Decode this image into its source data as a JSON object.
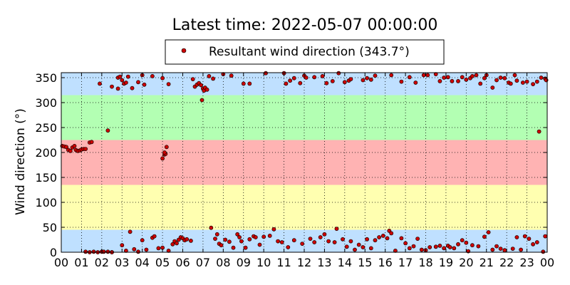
{
  "chart_data": {
    "type": "scatter",
    "title": "Latest time: 2022-05-07 00:00:00",
    "xlabel": "",
    "ylabel": "Wind direction (°)",
    "xlim": [
      0,
      24
    ],
    "ylim": [
      0,
      360
    ],
    "x_ticks": [
      "00",
      "01",
      "02",
      "03",
      "04",
      "05",
      "06",
      "07",
      "08",
      "09",
      "10",
      "11",
      "12",
      "13",
      "14",
      "15",
      "16",
      "17",
      "18",
      "19",
      "20",
      "21",
      "22",
      "23",
      "00"
    ],
    "y_ticks": [
      0,
      50,
      100,
      150,
      200,
      250,
      300,
      350
    ],
    "grid": true,
    "legend": {
      "placement": "top-center",
      "label": "Resultant wind direction (343.7°)"
    },
    "marker_color": "#cc0000",
    "bands": [
      {
        "from": 0,
        "to": 45,
        "color": "#bfe0ff"
      },
      {
        "from": 45,
        "to": 135,
        "color": "#ffffb0"
      },
      {
        "from": 135,
        "to": 225,
        "color": "#ffb3b3"
      },
      {
        "from": 225,
        "to": 315,
        "color": "#b3ffb3"
      },
      {
        "from": 315,
        "to": 360,
        "color": "#bfe0ff"
      }
    ],
    "series": [
      {
        "name": "Resultant wind direction (343.7°)",
        "points": [
          [
            0.05,
            213
          ],
          [
            0.15,
            212
          ],
          [
            0.25,
            211
          ],
          [
            0.35,
            205
          ],
          [
            0.45,
            203
          ],
          [
            0.55,
            210
          ],
          [
            0.65,
            213
          ],
          [
            0.72,
            205
          ],
          [
            0.82,
            203
          ],
          [
            0.92,
            204
          ],
          [
            1.0,
            206
          ],
          [
            1.1,
            207
          ],
          [
            1.2,
            207
          ],
          [
            1.4,
            220
          ],
          [
            1.5,
            221
          ],
          [
            1.2,
            1
          ],
          [
            1.4,
            0
          ],
          [
            1.6,
            1
          ],
          [
            1.8,
            0
          ],
          [
            2.0,
            1
          ],
          [
            2.1,
            1
          ],
          [
            2.3,
            1
          ],
          [
            2.5,
            0
          ],
          [
            2.5,
            0
          ],
          [
            1.9,
            338
          ],
          [
            2.3,
            244
          ],
          [
            2.5,
            332
          ],
          [
            2.8,
            328
          ],
          [
            2.8,
            350
          ],
          [
            2.9,
            352
          ],
          [
            3.0,
            345
          ],
          [
            3.1,
            338
          ],
          [
            3.2,
            340
          ],
          [
            3.3,
            352
          ],
          [
            3.5,
            329
          ],
          [
            3.8,
            341
          ],
          [
            4.0,
            355
          ],
          [
            4.1,
            336
          ],
          [
            4.5,
            353
          ],
          [
            5.0,
            349
          ],
          [
            5.3,
            337
          ],
          [
            3.0,
            14
          ],
          [
            3.2,
            3
          ],
          [
            3.4,
            41
          ],
          [
            3.6,
            6
          ],
          [
            3.8,
            1
          ],
          [
            4.0,
            24
          ],
          [
            4.2,
            5
          ],
          [
            4.5,
            29
          ],
          [
            4.6,
            32
          ],
          [
            4.8,
            8
          ],
          [
            5.0,
            9
          ],
          [
            5.3,
            3
          ],
          [
            5.0,
            188
          ],
          [
            5.1,
            196
          ],
          [
            5.15,
            197
          ],
          [
            5.2,
            211
          ],
          [
            5.1,
            200
          ],
          [
            5.5,
            16
          ],
          [
            5.6,
            22
          ],
          [
            5.7,
            18
          ],
          [
            5.8,
            25
          ],
          [
            5.9,
            30
          ],
          [
            6.0,
            28
          ],
          [
            6.1,
            24
          ],
          [
            6.2,
            26
          ],
          [
            6.4,
            23
          ],
          [
            6.5,
            347
          ],
          [
            6.6,
            332
          ],
          [
            6.7,
            336
          ],
          [
            6.8,
            339
          ],
          [
            6.9,
            335
          ],
          [
            6.95,
            305
          ],
          [
            7.0,
            328
          ],
          [
            7.05,
            324
          ],
          [
            7.1,
            330
          ],
          [
            7.2,
            326
          ],
          [
            7.3,
            353
          ],
          [
            7.5,
            348
          ],
          [
            7.4,
            49
          ],
          [
            7.6,
            27
          ],
          [
            7.7,
            36
          ],
          [
            7.8,
            17
          ],
          [
            7.9,
            14
          ],
          [
            8.1,
            25
          ],
          [
            8.3,
            21
          ],
          [
            8.5,
            9
          ],
          [
            8.7,
            36
          ],
          [
            8.8,
            30
          ],
          [
            8.9,
            22
          ],
          [
            9.1,
            9
          ],
          [
            9.3,
            26
          ],
          [
            9.5,
            32
          ],
          [
            9.6,
            30
          ],
          [
            9.8,
            15
          ],
          [
            10.0,
            31
          ],
          [
            10.3,
            33
          ],
          [
            10.5,
            46
          ],
          [
            10.7,
            22
          ],
          [
            10.9,
            20
          ],
          [
            8.0,
            357
          ],
          [
            8.4,
            354
          ],
          [
            9.0,
            338
          ],
          [
            9.3,
            338
          ],
          [
            10.1,
            359
          ],
          [
            11.0,
            359
          ],
          [
            11.1,
            338
          ],
          [
            11.3,
            344
          ],
          [
            11.5,
            349
          ],
          [
            11.8,
            339
          ],
          [
            12.0,
            354
          ],
          [
            12.1,
            350
          ],
          [
            12.5,
            351
          ],
          [
            12.9,
            353
          ],
          [
            13.1,
            339
          ],
          [
            13.4,
            343
          ],
          [
            13.7,
            359
          ],
          [
            14.0,
            341
          ],
          [
            14.2,
            344
          ],
          [
            14.3,
            347
          ],
          [
            14.9,
            345
          ],
          [
            11.2,
            10
          ],
          [
            11.5,
            24
          ],
          [
            11.9,
            17
          ],
          [
            12.3,
            27
          ],
          [
            12.5,
            20
          ],
          [
            12.8,
            30
          ],
          [
            13.0,
            36
          ],
          [
            13.2,
            22
          ],
          [
            13.5,
            20
          ],
          [
            13.6,
            47
          ],
          [
            13.9,
            26
          ],
          [
            14.1,
            11
          ],
          [
            14.3,
            22
          ],
          [
            14.5,
            5
          ],
          [
            14.7,
            15
          ],
          [
            14.9,
            10
          ],
          [
            15.1,
            26
          ],
          [
            15.3,
            8
          ],
          [
            15.5,
            24
          ],
          [
            15.7,
            30
          ],
          [
            15.9,
            33
          ],
          [
            16.1,
            28
          ],
          [
            16.2,
            43
          ],
          [
            16.3,
            38
          ],
          [
            16.5,
            3
          ],
          [
            16.8,
            28
          ],
          [
            17.0,
            18
          ],
          [
            17.2,
            8
          ],
          [
            17.4,
            12
          ],
          [
            17.6,
            27
          ],
          [
            17.8,
            5
          ],
          [
            18.0,
            4
          ],
          [
            18.2,
            10
          ],
          [
            18.5,
            11
          ],
          [
            18.7,
            13
          ],
          [
            18.9,
            8
          ],
          [
            19.1,
            13
          ],
          [
            19.2,
            10
          ],
          [
            19.4,
            8
          ],
          [
            19.6,
            16
          ],
          [
            19.8,
            24
          ],
          [
            20.0,
            19
          ],
          [
            20.1,
            2
          ],
          [
            20.3,
            14
          ],
          [
            20.6,
            12
          ],
          [
            20.9,
            31
          ],
          [
            21.1,
            40
          ],
          [
            21.3,
            5
          ],
          [
            21.5,
            12
          ],
          [
            21.7,
            7
          ],
          [
            21.9,
            4
          ],
          [
            22.3,
            7
          ],
          [
            22.5,
            30
          ],
          [
            22.7,
            5
          ],
          [
            22.9,
            32
          ],
          [
            23.1,
            27
          ],
          [
            23.3,
            16
          ],
          [
            23.5,
            20
          ],
          [
            23.8,
            1
          ],
          [
            23.9,
            32
          ],
          [
            15.1,
            349
          ],
          [
            15.3,
            346
          ],
          [
            15.5,
            354
          ],
          [
            16.3,
            355
          ],
          [
            16.8,
            342
          ],
          [
            17.2,
            351
          ],
          [
            17.5,
            340
          ],
          [
            17.9,
            355
          ],
          [
            18.1,
            355
          ],
          [
            18.5,
            357
          ],
          [
            18.7,
            343
          ],
          [
            18.9,
            350
          ],
          [
            19.1,
            351
          ],
          [
            19.3,
            343
          ],
          [
            19.6,
            343
          ],
          [
            19.8,
            351
          ],
          [
            20.0,
            346
          ],
          [
            20.2,
            349
          ],
          [
            20.3,
            353
          ],
          [
            20.5,
            355
          ],
          [
            20.7,
            338
          ],
          [
            20.9,
            349
          ],
          [
            21.0,
            355
          ],
          [
            21.3,
            330
          ],
          [
            21.5,
            345
          ],
          [
            21.7,
            350
          ],
          [
            21.9,
            349
          ],
          [
            22.1,
            340
          ],
          [
            22.2,
            338
          ],
          [
            22.4,
            355
          ],
          [
            22.5,
            344
          ],
          [
            22.8,
            340
          ],
          [
            23.0,
            342
          ],
          [
            23.3,
            337
          ],
          [
            23.5,
            342
          ],
          [
            23.7,
            350
          ],
          [
            23.9,
            348
          ],
          [
            23.95,
            345
          ],
          [
            23.6,
            242
          ]
        ]
      }
    ]
  }
}
